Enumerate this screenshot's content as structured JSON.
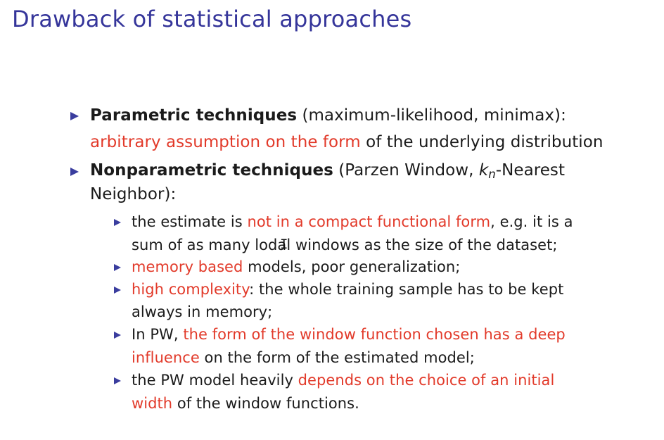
{
  "slide": {
    "title": "Drawback of statistical approaches"
  },
  "bullets": {
    "parametric": {
      "heading": "Parametric techniques",
      "paren": " (maximum-likelihood, minimax):",
      "red": "arbitrary assumption on the form",
      "rest": " of the underlying distribution"
    },
    "nonparametric": {
      "heading": "Nonparametric techniques",
      "paren_pre": " (Parzen Window, ",
      "k": "k",
      "n": "n",
      "paren_post": "-Nearest",
      "line2": "Neighbor):"
    },
    "sub": {
      "s1": {
        "pre": "the estimate is ",
        "red": "not in a compact functional form",
        "post": ", e.g.  it is a",
        "line2": "sum of as many lodal windows as the size of the dataset;"
      },
      "s2": {
        "red": "memory based",
        "post": " models, poor generalization;"
      },
      "s3": {
        "red": "high complexity",
        "post": ": the whole training sample has to be kept",
        "line2": "always in memory;"
      },
      "s4": {
        "pre": "In PW, ",
        "red": "the form of the window function chosen has a deep",
        "line2_red": "influence",
        "line2_post": " on the form of the estimated model;"
      },
      "s5": {
        "pre": "the PW model heavily ",
        "red": "depends on the choice of an initial",
        "line2_red": "width",
        "line2_post": " of the window functions."
      }
    }
  },
  "colors": {
    "title": "#35359a",
    "bullet": "#3a3d9e",
    "highlight": "#e23a2a",
    "text": "#1b1b1b"
  },
  "icons": {
    "bullet": "triangle-bullet-icon",
    "cursor": "text-cursor-icon"
  }
}
